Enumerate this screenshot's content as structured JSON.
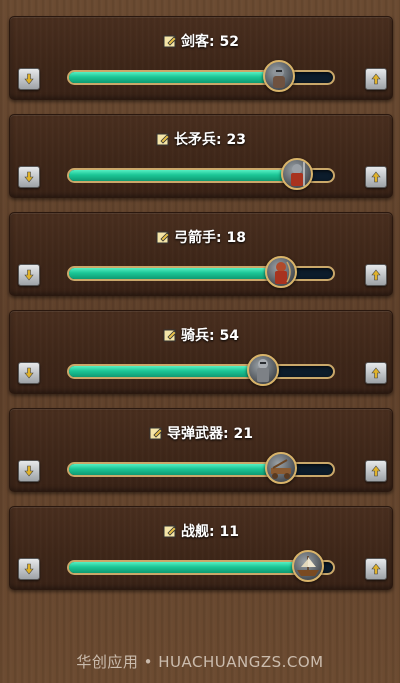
{
  "units": [
    {
      "label": "剑客: 52",
      "fill": 0.79,
      "unit_icon": "swordsman-icon"
    },
    {
      "label": "长矛兵: 23",
      "fill": 0.86,
      "unit_icon": "spearman-icon"
    },
    {
      "label": "弓箭手: 18",
      "fill": 0.8,
      "unit_icon": "archer-icon"
    },
    {
      "label": "骑兵: 54",
      "fill": 0.73,
      "unit_icon": "cavalry-icon"
    },
    {
      "label": "导弹武器: 21",
      "fill": 0.8,
      "unit_icon": "siege-weapon-icon"
    },
    {
      "label": "战舰: 11",
      "fill": 0.9,
      "unit_icon": "warship-icon"
    }
  ],
  "watermark": "华创应用 • HUACHUANGZS.COM",
  "colors": {
    "fill": "#1bc696",
    "track": "#0c1c2b",
    "frame": "#caa86a"
  }
}
